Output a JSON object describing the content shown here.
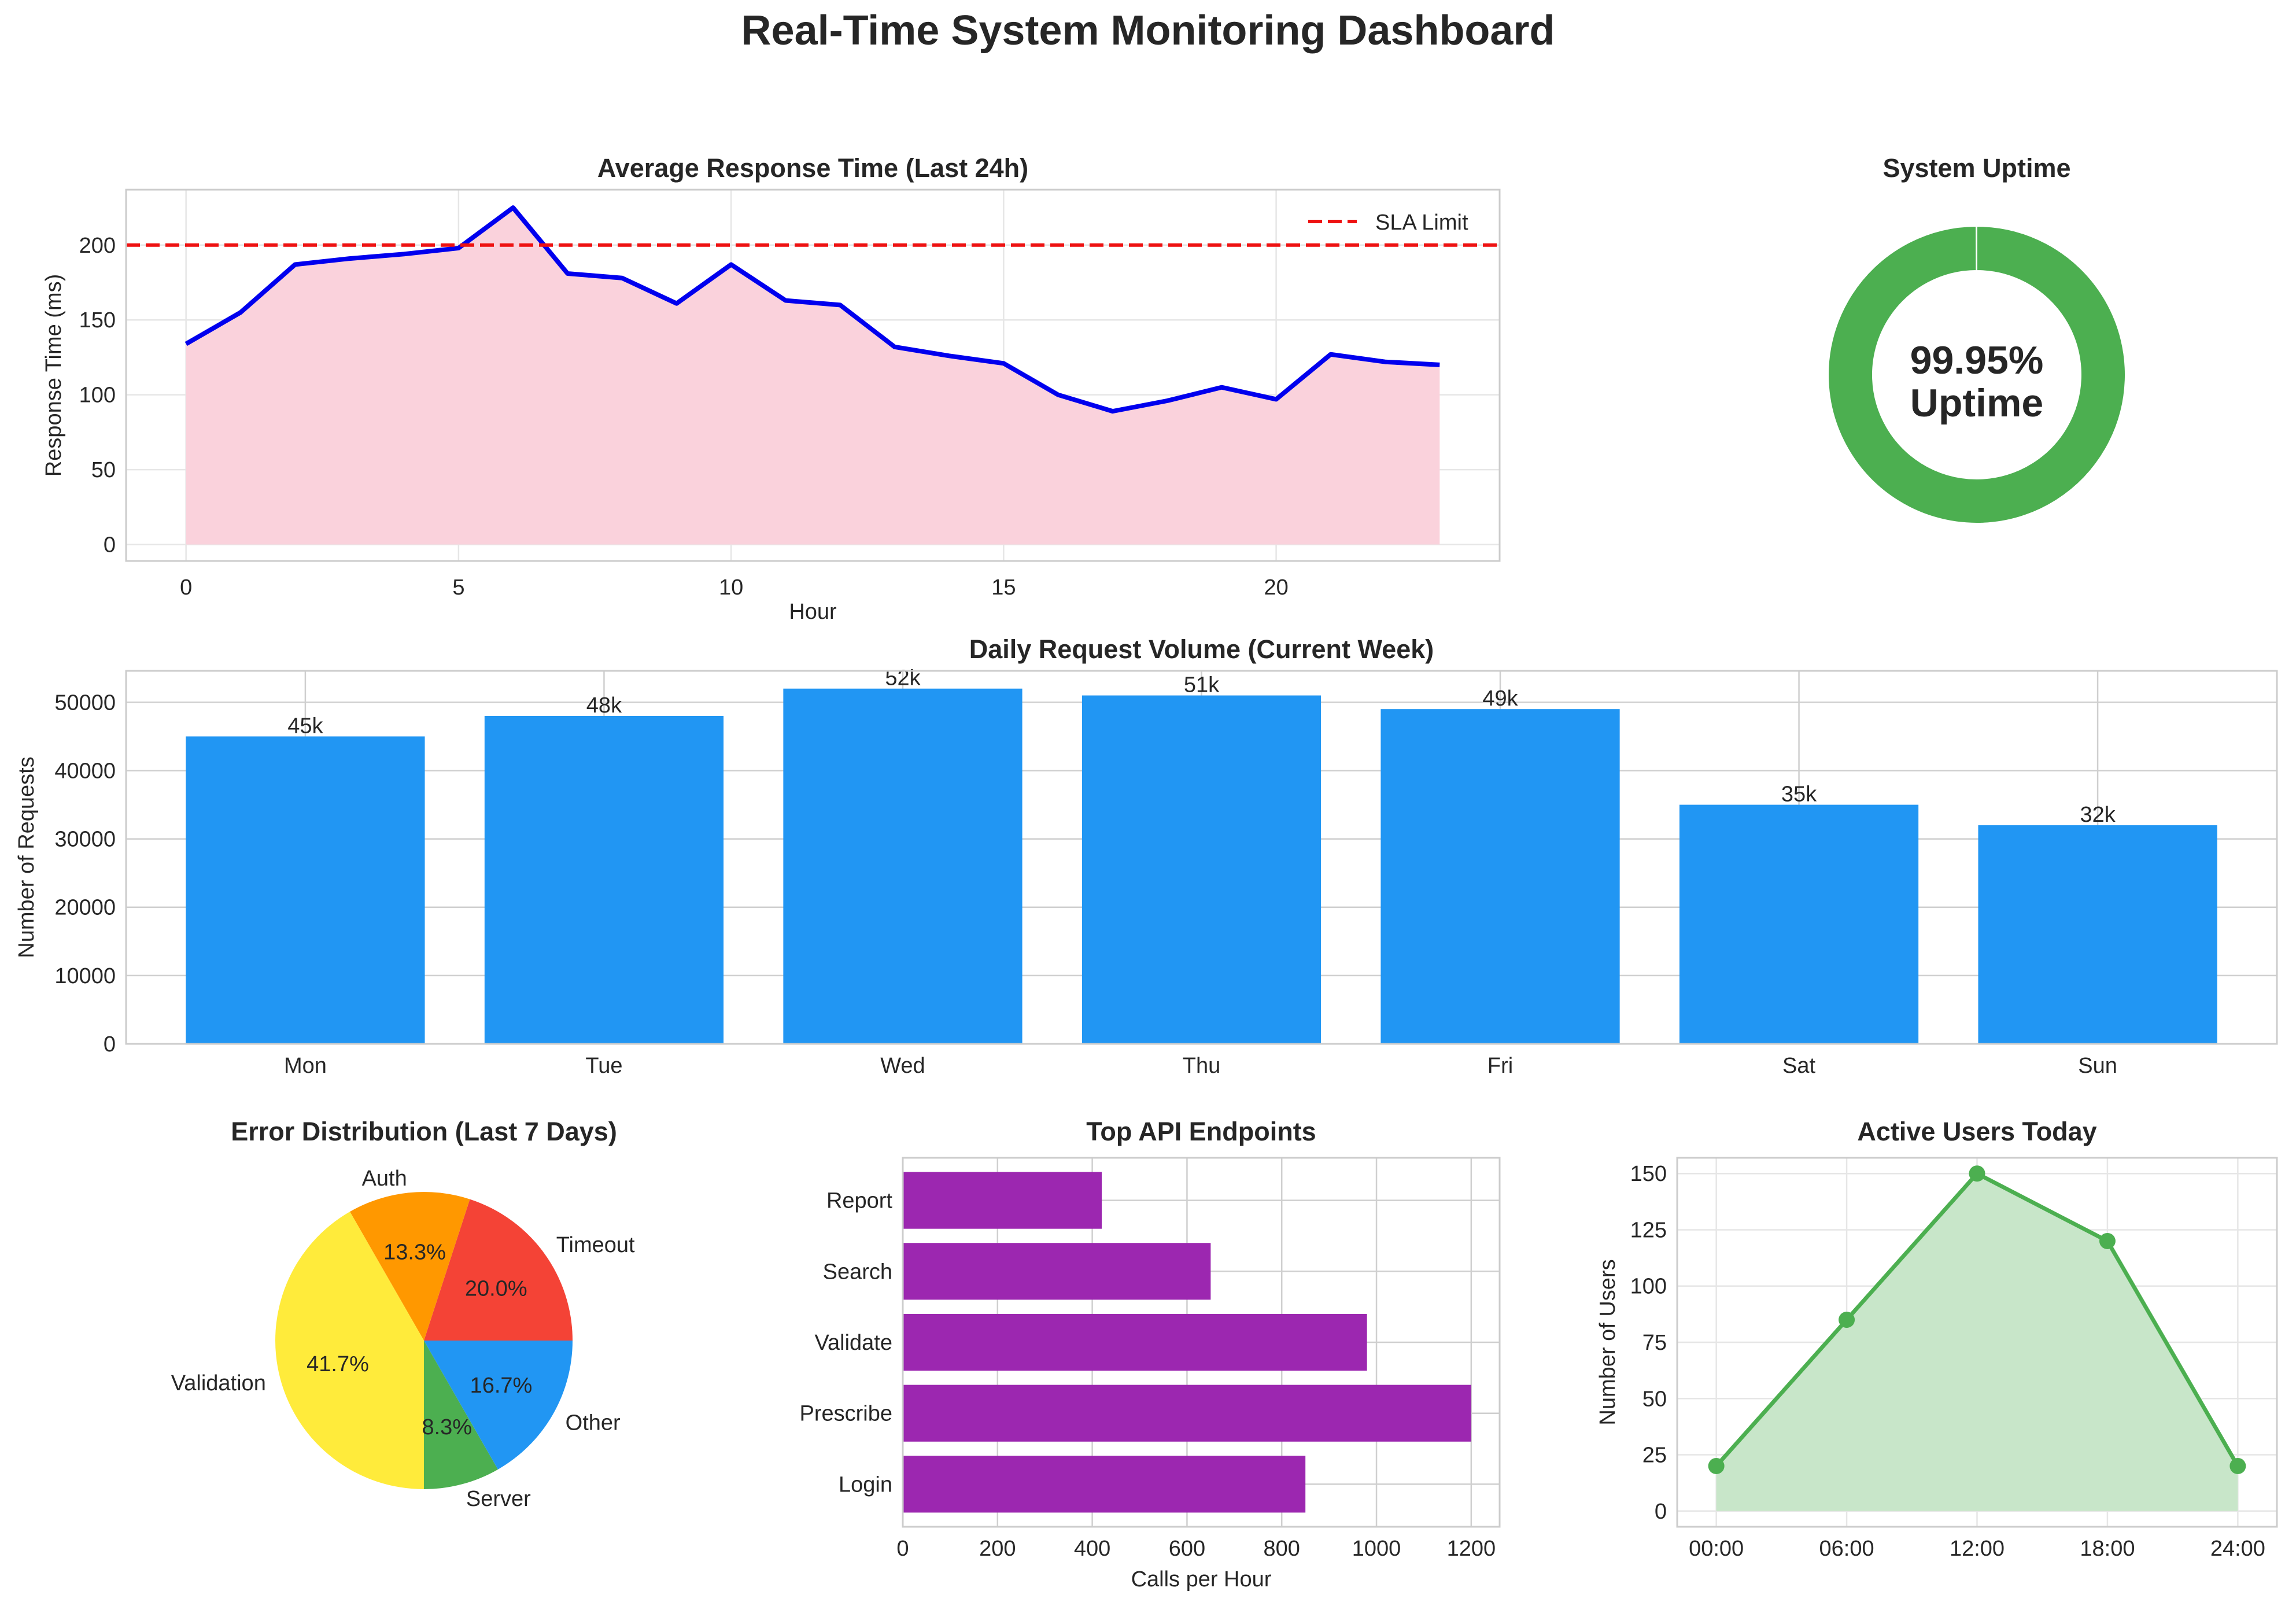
{
  "title": "Real-Time System Monitoring Dashboard",
  "colors": {
    "line_blue": "#0000ee",
    "area_pink": "#fad2dc",
    "sla_red": "#ee1111",
    "bar_blue": "#2196f3",
    "uptime_green": "#4caf50",
    "endpoint_purple": "#9c27b0",
    "users_green": "#4caf50",
    "users_fill": "#c8e6c9"
  },
  "chart_data": [
    {
      "type": "area",
      "title": "Average Response Time (Last 24h)",
      "xlabel": "Hour",
      "ylabel": "Response Time (ms)",
      "x": [
        0,
        1,
        2,
        3,
        4,
        5,
        6,
        7,
        8,
        9,
        10,
        11,
        12,
        13,
        14,
        15,
        16,
        17,
        18,
        19,
        20,
        21,
        22,
        23
      ],
      "values": [
        134,
        155,
        187,
        191,
        194,
        198,
        225,
        181,
        178,
        161,
        187,
        163,
        160,
        132,
        126,
        121,
        100,
        89,
        96,
        105,
        97,
        127,
        122,
        120
      ],
      "xticks": [
        0,
        5,
        10,
        15,
        20
      ],
      "yticks": [
        0,
        50,
        100,
        150,
        200
      ],
      "xlim": [
        -1.1,
        24.1
      ],
      "ylim": [
        -11,
        237
      ],
      "sla_limit": 200,
      "legend": [
        "SLA Limit"
      ],
      "legend_position": "upper right",
      "grid": true
    },
    {
      "type": "pie",
      "title": "System Uptime",
      "values": [
        99.95,
        0.05
      ],
      "center_label_line1": "99.95%",
      "center_label_line2": "Uptime"
    },
    {
      "type": "bar",
      "title": "Daily Request Volume (Current Week)",
      "ylabel": "Number of Requests",
      "categories": [
        "Mon",
        "Tue",
        "Wed",
        "Thu",
        "Fri",
        "Sat",
        "Sun"
      ],
      "values": [
        45000,
        48000,
        52000,
        51000,
        49000,
        35000,
        32000
      ],
      "data_labels": [
        "45k",
        "48k",
        "52k",
        "51k",
        "49k",
        "35k",
        "32k"
      ],
      "yticks": [
        0,
        10000,
        20000,
        30000,
        40000,
        50000
      ],
      "ylim": [
        0,
        54600
      ],
      "grid": true
    },
    {
      "type": "pie",
      "title": "Error Distribution (Last 7 Days)",
      "labels": [
        "Timeout",
        "Auth",
        "Validation",
        "Server",
        "Other"
      ],
      "values": [
        20.0,
        13.3,
        41.7,
        8.3,
        16.7
      ],
      "pct_labels": [
        "20.0%",
        "13.3%",
        "41.7%",
        "8.3%",
        "16.7%"
      ],
      "colors": [
        "#f44336",
        "#ff9800",
        "#ffeb3b",
        "#4caf50",
        "#2196f3"
      ]
    },
    {
      "type": "bar",
      "orientation": "horizontal",
      "title": "Top API Endpoints",
      "xlabel": "Calls per Hour",
      "categories": [
        "Login",
        "Prescribe",
        "Validate",
        "Search",
        "Report"
      ],
      "values": [
        850,
        1200,
        980,
        650,
        420
      ],
      "xticks": [
        0,
        200,
        400,
        600,
        800,
        1000,
        1200
      ],
      "xlim": [
        0,
        1260
      ],
      "grid": true
    },
    {
      "type": "area",
      "title": "Active Users Today",
      "ylabel": "Number of Users",
      "categories": [
        "00:00",
        "06:00",
        "12:00",
        "18:00",
        "24:00"
      ],
      "values": [
        20,
        85,
        150,
        120,
        20
      ],
      "yticks": [
        0,
        25,
        50,
        75,
        100,
        125,
        150
      ],
      "ylim": [
        -7,
        157
      ],
      "grid": true
    }
  ]
}
